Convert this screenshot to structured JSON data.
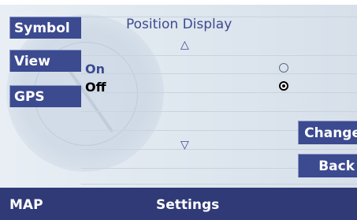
{
  "sidebar": {
    "items": [
      {
        "label": "Symbol"
      },
      {
        "label": "View"
      },
      {
        "label": "GPS"
      }
    ]
  },
  "main": {
    "title": "Position Display",
    "scroll_up_icon": "triangle-up-icon",
    "scroll_down_icon": "triangle-down-icon",
    "options": [
      {
        "label": "On",
        "selected": false
      },
      {
        "label": "Off",
        "selected": true
      }
    ]
  },
  "actions": {
    "change_label": "Change",
    "back_label": "Back"
  },
  "bottom_bar": {
    "mode_label": "MAP",
    "section_label": "Settings"
  },
  "colors": {
    "accent": "#3c4a8f",
    "bottom_bar": "#2f3a77",
    "background": "#dfe7ef"
  }
}
